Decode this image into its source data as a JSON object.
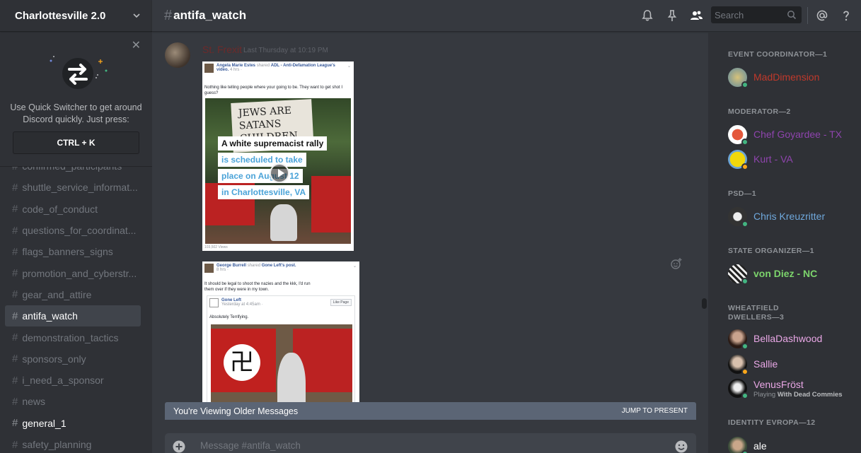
{
  "server": {
    "name": "Charlottesville 2.0"
  },
  "quick_switcher": {
    "text": "Use Quick Switcher to get around Discord quickly. Just press:",
    "shortcut": "CTRL + K"
  },
  "channels": [
    {
      "name": "confirmed_participants"
    },
    {
      "name": "shuttle_service_informat..."
    },
    {
      "name": "code_of_conduct"
    },
    {
      "name": "questions_for_coordinat..."
    },
    {
      "name": "flags_banners_signs"
    },
    {
      "name": "promotion_and_cyberstr..."
    },
    {
      "name": "gear_and_attire"
    },
    {
      "name": "antifa_watch"
    },
    {
      "name": "demonstration_tactics"
    },
    {
      "name": "sponsors_only"
    },
    {
      "name": "i_need_a_sponsor"
    },
    {
      "name": "news"
    },
    {
      "name": "general_1"
    },
    {
      "name": "safety_planning"
    }
  ],
  "header": {
    "hash": "#",
    "channel": "antifa_watch",
    "search_placeholder": "Search"
  },
  "message": {
    "author": "St. Frexit",
    "time": "Last Thursday at 10:19 PM",
    "post1": {
      "sharer": "Angela Marie Estes",
      "shared": "shared",
      "source": "ADL - Anti-Defamation League's",
      "video": "video.",
      "meta": "4 hrs ·",
      "text": "Nothing like telling people where your going to be. They want to get shot I guess?",
      "sign": "JEWS ARE SATANS CHILDREN",
      "overlay": [
        "A white supremacist rally",
        "is scheduled to take",
        "place on August 12",
        "in Charlottesville, VA"
      ],
      "views": "103,502 Views"
    },
    "post2": {
      "sharer": "George Burrell",
      "shared": "shared",
      "source": "Gone Left's",
      "post": "post.",
      "meta": "8 hrs ·",
      "text": "It should be legal to shoot the nazies and the kkk, I'd run them over if they were in my town.",
      "inner_page": "Gone Left",
      "inner_meta": "Yesterday at 4:45am ·",
      "like_page": "Like Page",
      "inner_text": "Absolutely Terrifying."
    }
  },
  "older_bar": {
    "text": "You're Viewing Older Messages",
    "jump": "JUMP TO PRESENT"
  },
  "composer": {
    "placeholder": "Message #antifa_watch"
  },
  "roles": [
    {
      "title": "EVENT COORDINATOR—1"
    },
    {
      "title": "MODERATOR—2"
    },
    {
      "title": "PSD—1"
    },
    {
      "title": "STATE ORGANIZER—1"
    },
    {
      "title": "WHEATFIELD DWELLERS—3"
    },
    {
      "title": "IDENTITY EVROPA—12"
    }
  ],
  "members": [
    {
      "name": "MadDimension",
      "color": "#c0392b",
      "status": "online"
    },
    {
      "name": "Chef Goyardee - TX",
      "color": "#8e44ad",
      "status": "online"
    },
    {
      "name": "Kurt - VA",
      "color": "#8e44ad",
      "status": "idle"
    },
    {
      "name": "Chris Kreuzritter",
      "color": "#6fa8dc",
      "status": "online"
    },
    {
      "name": "von Diez - NC",
      "color": "#7cd46c",
      "status": "online"
    },
    {
      "name": "BellaDashwood",
      "color": "#e9a7e6",
      "status": "online"
    },
    {
      "name": "Sallie",
      "color": "#e9a7e6",
      "status": "idle"
    },
    {
      "name": "VenusFröst",
      "color": "#e9a7e6",
      "status": "online",
      "activity_prefix": "Playing",
      "activity": "With Dead Commies"
    },
    {
      "name": "ale",
      "color": "#ffffff",
      "status": "online"
    }
  ],
  "colors": {
    "online": "#43b581",
    "idle": "#faa61a"
  }
}
